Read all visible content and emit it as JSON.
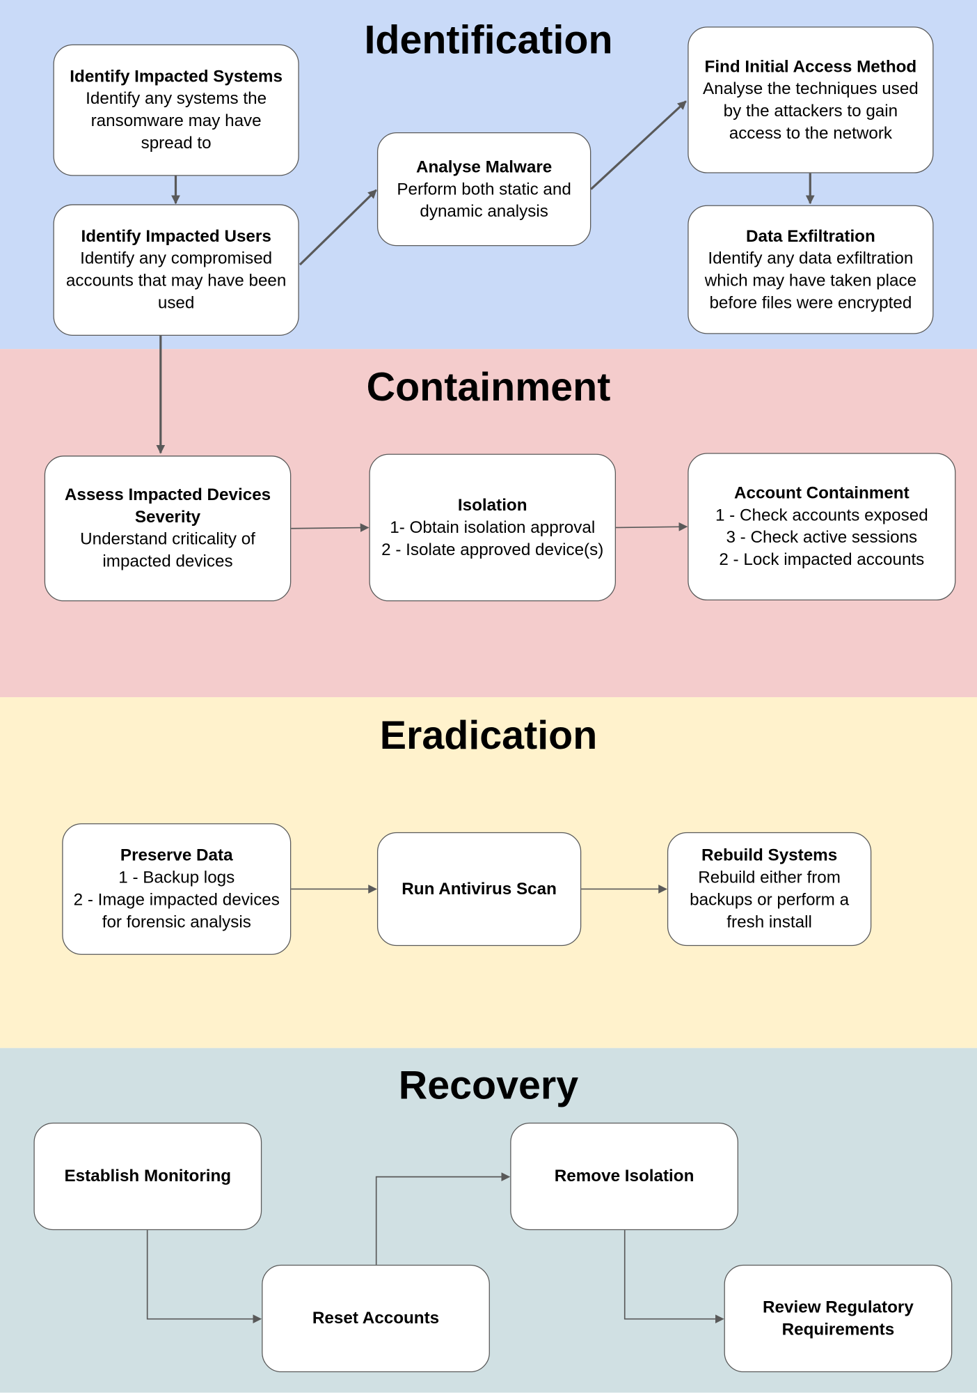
{
  "sections": [
    {
      "title": "Identification",
      "color": "#c9daf8"
    },
    {
      "title": "Containment",
      "color": "#f4cccc"
    },
    {
      "title": "Eradication",
      "color": "#fff2cc"
    },
    {
      "title": "Recovery",
      "color": "#d0e0e3"
    }
  ],
  "boxes": {
    "impacted_systems": {
      "title": "Identify Impacted Systems",
      "body": "Identify any systems the ransomware may have spread to"
    },
    "impacted_users": {
      "title": "Identify Impacted Users",
      "body": "Identify any compromised accounts that may have been used"
    },
    "analyse_malware": {
      "title": "Analyse Malware",
      "body": "Perform both static and dynamic analysis"
    },
    "initial_access": {
      "title": "Find Initial Access Method",
      "body": "Analyse the techniques used by the attackers to gain access to the network"
    },
    "data_exfiltration": {
      "title": "Data Exfiltration",
      "body": "Identify any data exfiltration which may have taken place before files were encrypted"
    },
    "assess_severity": {
      "title": "Assess Impacted Devices Severity",
      "body": "Understand criticality of impacted devices"
    },
    "isolation": {
      "title": "Isolation",
      "lines": [
        "1- Obtain isolation approval",
        "2 - Isolate approved device(s)"
      ]
    },
    "account_containment": {
      "title": "Account Containment",
      "lines": [
        "1 - Check accounts exposed",
        "3 - Check active sessions",
        "2 - Lock impacted accounts"
      ]
    },
    "preserve_data": {
      "title": "Preserve Data",
      "lines": [
        "1 - Backup logs",
        "2 - Image impacted devices for forensic analysis"
      ]
    },
    "run_antivirus": {
      "title": "Run Antivirus Scan"
    },
    "rebuild_systems": {
      "title": "Rebuild Systems",
      "body": "Rebuild either from backups or perform a fresh install"
    },
    "establish_monitoring": {
      "title": "Establish Monitoring"
    },
    "reset_accounts": {
      "title": "Reset Accounts"
    },
    "remove_isolation": {
      "title": "Remove Isolation"
    },
    "review_regulatory": {
      "title": "Review Regulatory Requirements"
    }
  }
}
